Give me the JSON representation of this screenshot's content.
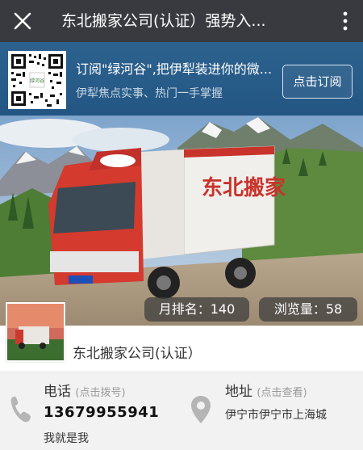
{
  "header": {
    "title": "东北搬家公司(认证）强势入...",
    "close_icon": "close-icon",
    "more_icon": "more-vertical-icon"
  },
  "banner": {
    "line1": "订阅\"绿河谷\",把伊犁装进你的微...",
    "line2": "伊犁焦点实事、热门一手掌握",
    "subscribe_label": "点击订阅",
    "qr_center_text": "绿河谷"
  },
  "hero": {
    "truck_text": "东北搬家",
    "rank_badge": "月排名：140",
    "views_badge": "浏览量：58"
  },
  "company": {
    "name": "东北搬家公司(认证）"
  },
  "contact": {
    "phone_label": "电话",
    "phone_hint": "(点击拨号)",
    "phone_number": "13679955941",
    "note": "我就是我",
    "address_label": "地址",
    "address_hint": "(点击查看)",
    "address": "伊宁市伊宁市上海城"
  },
  "colors": {
    "titlebar": "#393a3f",
    "banner": "#2a5f8c",
    "info_bg": "#f2f2f2",
    "icon_gray": "#b5b5b5"
  }
}
